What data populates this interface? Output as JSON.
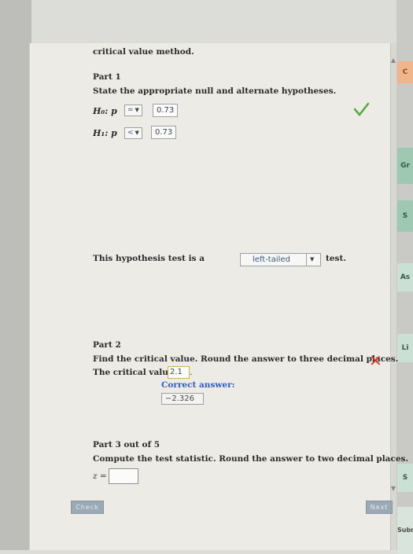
{
  "heading": "critical value method.",
  "part1": {
    "title": "Part 1",
    "instruction": "State the appropriate null and alternate hypotheses.",
    "h0": {
      "label": "H₀: p",
      "operator": "=",
      "value": "0.73"
    },
    "h1": {
      "label": "H₁: p",
      "operator": "<",
      "value": "0.73"
    },
    "test_prefix": "This hypothesis test is a",
    "test_type": "left-tailed",
    "test_suffix": "test."
  },
  "part2": {
    "title": "Part 2",
    "instruction": "Find the critical value. Round the answer to three decimal places.",
    "critical_prefix": "The critical value is",
    "critical_input": "2.1",
    "period": ".",
    "correct_label": "Correct answer:",
    "correct_value": "−2.326"
  },
  "part3": {
    "title": "Part 3 out of 5",
    "instruction": "Compute the test statistic. Round the answer to two decimal places.",
    "z_label": "z ="
  },
  "buttons": {
    "check": "Check",
    "next": "Next"
  },
  "side_tabs": [
    "C",
    "Gr",
    "S",
    "As",
    "Li",
    "S",
    "Subm"
  ],
  "colors": {
    "correct": "#5aa83c",
    "incorrect": "#d43a2a",
    "link": "#2b5cc8",
    "accent_tab": "#f0b58b"
  }
}
